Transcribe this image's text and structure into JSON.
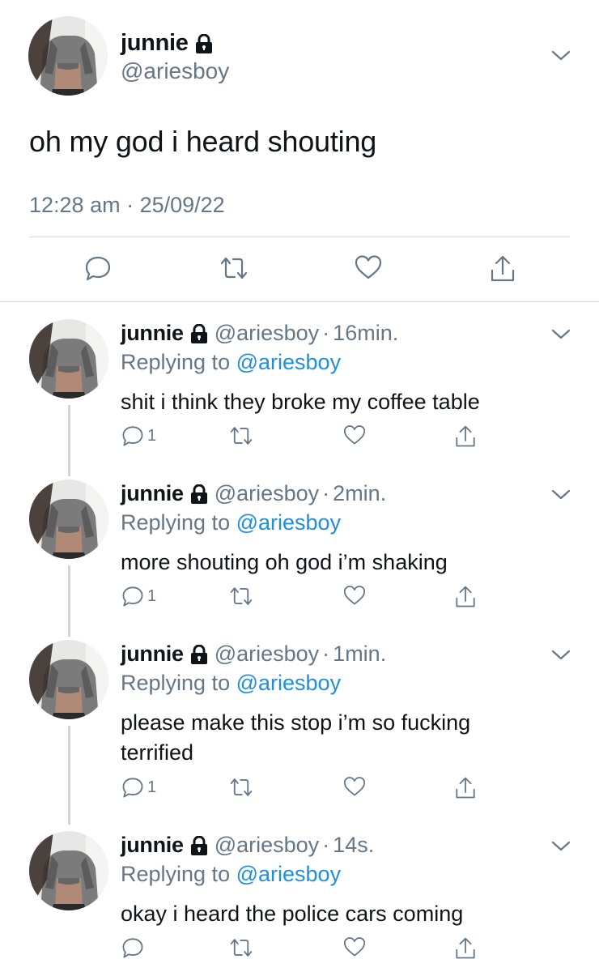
{
  "main_tweet": {
    "name": "junnie",
    "handle": "@ariesboy",
    "text": "oh my god i heard shouting",
    "timestamp": "12:28 am · 25/09/22"
  },
  "replies": [
    {
      "name": "junnie",
      "handle": "@ariesboy",
      "separator": "·",
      "time": "16min.",
      "replying_prefix": "Replying to",
      "replying_to": "@ariesboy",
      "text": "shit i think they broke my coffee table",
      "reply_count": "1"
    },
    {
      "name": "junnie",
      "handle": "@ariesboy",
      "separator": "·",
      "time": "2min.",
      "replying_prefix": "Replying to",
      "replying_to": "@ariesboy",
      "text": "more shouting oh god i’m shaking",
      "reply_count": "1"
    },
    {
      "name": "junnie",
      "handle": "@ariesboy",
      "separator": "·",
      "time": "1min.",
      "replying_prefix": "Replying to",
      "replying_to": "@ariesboy",
      "text": "please make this stop i’m so fucking terrified",
      "reply_count": "1"
    },
    {
      "name": "junnie",
      "handle": "@ariesboy",
      "separator": "·",
      "time": "14s.",
      "replying_prefix": "Replying to",
      "replying_to": "@ariesboy",
      "text": "okay i heard the police cars coming",
      "reply_count": ""
    }
  ],
  "icons": {
    "lock": "lock-icon",
    "chevron": "chevron-down-icon",
    "reply": "reply-icon",
    "retweet": "retweet-icon",
    "like": "heart-icon",
    "share": "share-icon"
  },
  "colors": {
    "link": "#1d8fe0",
    "secondary": "#657786",
    "divider": "#d9dde0"
  }
}
